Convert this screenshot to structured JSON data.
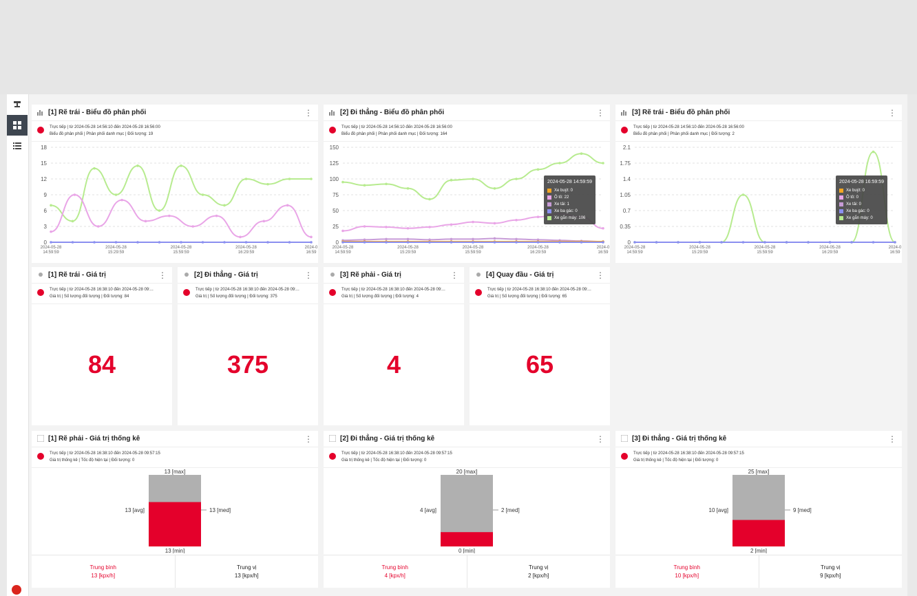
{
  "colors": {
    "accent": "#e4002b",
    "green": "#b7eb8f",
    "pink": "#e9a5e7",
    "blue": "#8a8ff0",
    "orange": "#f5a623",
    "gray": "#b0b0b0"
  },
  "distribution_cards": [
    {
      "title": "[1] Rẽ trái - Biểu đồ phân phối",
      "meta1": "Trực tiếp | từ 2024-05-28 14:56:10 đến 2024-05-28 16:56:00",
      "meta2": "Biểu đồ phân phối | Phân phối danh mục | Đối tượng: 19",
      "yticks": [
        "18",
        "15",
        "12",
        "9",
        "6",
        "3",
        "0"
      ],
      "xticks": [
        [
          "2024-05-28",
          "14:59:59"
        ],
        [
          "2024-05-28",
          "15:29:59"
        ],
        [
          "2024-05-28",
          "15:59:59"
        ],
        [
          "2024-05-28",
          "16:29:59"
        ],
        [
          "2024-0",
          "16:59"
        ]
      ]
    },
    {
      "title": "[2] Đi thẳng - Biểu đồ phân phối",
      "meta1": "Trực tiếp | từ 2024-05-28 14:56:10 đến 2024-05-28 16:56:00",
      "meta2": "Biểu đồ phân phối | Phân phối danh mục | Đối tượng: 164",
      "yticks": [
        "150",
        "125",
        "100",
        "75",
        "50",
        "25",
        "0"
      ],
      "xticks": [
        [
          "2024-05-28",
          "14:59:59"
        ],
        [
          "2024-05-28",
          "15:29:59"
        ],
        [
          "2024-05-28",
          "15:59:59"
        ],
        [
          "2024-05-28",
          "16:29:59"
        ],
        [
          "2024-0",
          "16:59"
        ]
      ],
      "tooltip": {
        "time": "2024-05-28 14:59:59",
        "rows": [
          {
            "label": "Xe buýt: 0",
            "color": "#f5a623"
          },
          {
            "label": "Ô tô: 22",
            "color": "#e9a5e7"
          },
          {
            "label": "Xe tải: 1",
            "color": "#c79bd6"
          },
          {
            "label": "Xe ba gác: 0",
            "color": "#8a8ff0"
          },
          {
            "label": "Xe gắn máy: 106",
            "color": "#b7eb8f"
          }
        ]
      }
    },
    {
      "title": "[3] Rẽ trái - Biểu đồ phân phối",
      "meta1": "Trực tiếp | từ 2024-05-28 14:56:10 đến 2024-05-28 16:56:00",
      "meta2": "Biểu đồ phân phối | Phân phối danh mục | Đối tượng: 2",
      "yticks": [
        "2.1",
        "1.75",
        "1.4",
        "1.05",
        "0.7",
        "0.35",
        "0"
      ],
      "xticks": [
        [
          "2024-05-28",
          "14:59:59"
        ],
        [
          "2024-05-28",
          "15:29:59"
        ],
        [
          "2024-05-28",
          "15:59:59"
        ],
        [
          "2024-05-28",
          "16:29:59"
        ],
        [
          "2024-0",
          "16:59"
        ]
      ],
      "tooltip": {
        "time": "2024-05-28 16:59:59",
        "rows": [
          {
            "label": "Xe buýt: 0",
            "color": "#f5a623"
          },
          {
            "label": "Ô tô: 0",
            "color": "#e9a5e7"
          },
          {
            "label": "Xe tải: 0",
            "color": "#c79bd6"
          },
          {
            "label": "Xe ba gác: 0",
            "color": "#8a8ff0"
          },
          {
            "label": "Xe gắn máy: 0",
            "color": "#b7eb8f"
          }
        ]
      }
    }
  ],
  "chart_data": [
    {
      "type": "line",
      "ylim": [
        0,
        18
      ],
      "x": [
        "14:59:59",
        "15:07",
        "15:14",
        "15:22",
        "15:29:59",
        "15:37",
        "15:44",
        "15:52",
        "15:59:59",
        "16:07",
        "16:14",
        "16:22",
        "16:29:59",
        "16:37",
        "16:44",
        "16:52",
        "16:59"
      ],
      "series": [
        {
          "color": "#b7eb8f",
          "values": [
            7,
            4,
            14,
            9,
            14.5,
            6,
            14.5,
            9,
            7,
            12,
            11,
            12,
            12
          ]
        },
        {
          "color": "#e9a5e7",
          "values": [
            2,
            9,
            3,
            8,
            4,
            5,
            3,
            5,
            1,
            4,
            7,
            1
          ]
        },
        {
          "color": "#8a8ff0",
          "values": [
            0,
            0,
            0,
            0,
            0,
            0,
            0,
            0,
            0,
            0,
            0,
            0,
            0
          ]
        }
      ]
    },
    {
      "type": "line",
      "ylim": [
        0,
        150
      ],
      "series": [
        {
          "color": "#b7eb8f",
          "values": [
            95,
            90,
            92,
            85,
            68,
            98,
            100,
            85,
            100,
            115,
            125,
            140,
            125
          ]
        },
        {
          "color": "#e9a5e7",
          "values": [
            18,
            25,
            24,
            22,
            24,
            28,
            32,
            30,
            35,
            40,
            45,
            40,
            22
          ]
        },
        {
          "color": "#c79bd6",
          "values": [
            3,
            4,
            5,
            5,
            4,
            5,
            5,
            6,
            5,
            4,
            3,
            2,
            1
          ]
        },
        {
          "color": "#f5a623",
          "values": [
            1,
            1,
            1,
            1,
            1,
            1,
            1,
            1,
            1,
            1,
            1,
            1,
            1
          ]
        },
        {
          "color": "#8a8ff0",
          "values": [
            0,
            0,
            0,
            0,
            0,
            0,
            0,
            0,
            0,
            0,
            0,
            0,
            0
          ]
        }
      ]
    },
    {
      "type": "line",
      "ylim": [
        0,
        2.1
      ],
      "series": [
        {
          "color": "#b7eb8f",
          "values": [
            0,
            0,
            0,
            0,
            0,
            1.05,
            0,
            0,
            0,
            0,
            0,
            2.0,
            0
          ]
        },
        {
          "color": "#8a8ff0",
          "values": [
            0,
            0,
            0,
            0,
            0,
            0,
            0,
            0,
            0,
            0,
            0,
            0,
            0
          ]
        }
      ]
    }
  ],
  "value_cards": [
    {
      "title": "[1] Rẽ trái - Giá trị",
      "meta1": "Trực tiếp | từ 2024-05-28 16:38:10 đến 2024-05-28 09:...",
      "meta2": "Giá trị | Số lượng đối tượng | Đối tượng: 84",
      "value": "84"
    },
    {
      "title": "[2] Đi thẳng - Giá trị",
      "meta1": "Trực tiếp | từ 2024-05-28 16:38:10 đến 2024-05-28 09:...",
      "meta2": "Giá trị | Số lượng đối tượng | Đối tượng: 375",
      "value": "375"
    },
    {
      "title": "[3] Rẽ phải - Giá trị",
      "meta1": "Trực tiếp | từ 2024-05-28 16:38:10 đến 2024-05-28 09:...",
      "meta2": "Giá trị | Số lượng đối tượng | Đối tượng: 4",
      "value": "4"
    },
    {
      "title": "[4] Quay đầu - Giá trị",
      "meta1": "Trực tiếp | từ 2024-05-28 16:38:10 đến 2024-05-28 09:...",
      "meta2": "Giá trị | Số lượng đối tượng | Đối tượng: 65",
      "value": "65"
    }
  ],
  "stat_cards": [
    {
      "title": "[1] Rẽ phải - Giá trị thống kê",
      "meta1": "Trực tiếp | từ 2024-05-28 16:38:10 đến 2024-05-28 09:57:15",
      "meta2": "Giá trị thống kê | Tốc độ hiện tại | Đối tượng: 0",
      "max": 13,
      "min": 13,
      "avg_fill": 0.62,
      "label_max": "13 [max]",
      "label_min": "13 [min]",
      "label_avg": "13 [avg]",
      "label_med": "13 [med]",
      "avg_title": "Trung bình",
      "avg_value": "13 [kpx/h]",
      "med_title": "Trung vị",
      "med_value": "13 [kpx/h]"
    },
    {
      "title": "[2] Đi thẳng - Giá trị thống kê",
      "meta1": "Trực tiếp | từ 2024-05-28 16:38:10 đến 2024-05-28 09:57:15",
      "meta2": "Giá trị thống kê | Tốc độ hiện tại | Đối tượng: 0",
      "max": 20,
      "min": 0,
      "avg_fill": 0.2,
      "label_max": "20 [max]",
      "label_min": "0 [min]",
      "label_avg": "4 [avg]",
      "label_med": "2 [med]",
      "avg_title": "Trung bình",
      "avg_value": "4 [kpx/h]",
      "med_title": "Trung vị",
      "med_value": "2 [kpx/h]"
    },
    {
      "title": "[3] Đi thẳng - Giá trị thống kê",
      "meta1": "Trực tiếp | từ 2024-05-28 16:38:10 đến 2024-05-28 09:57:15",
      "meta2": "Giá trị thống kê | Tốc độ hiện tại | Đối tượng: 0",
      "max": 25,
      "min": 2,
      "avg_fill": 0.37,
      "label_max": "25 [max]",
      "label_min": "2 [min]",
      "label_avg": "10 [avg]",
      "label_med": "9 [med]",
      "avg_title": "Trung bình",
      "avg_value": "10 [kpx/h]",
      "med_title": "Trung vị",
      "med_value": "9 [kpx/h]"
    }
  ]
}
